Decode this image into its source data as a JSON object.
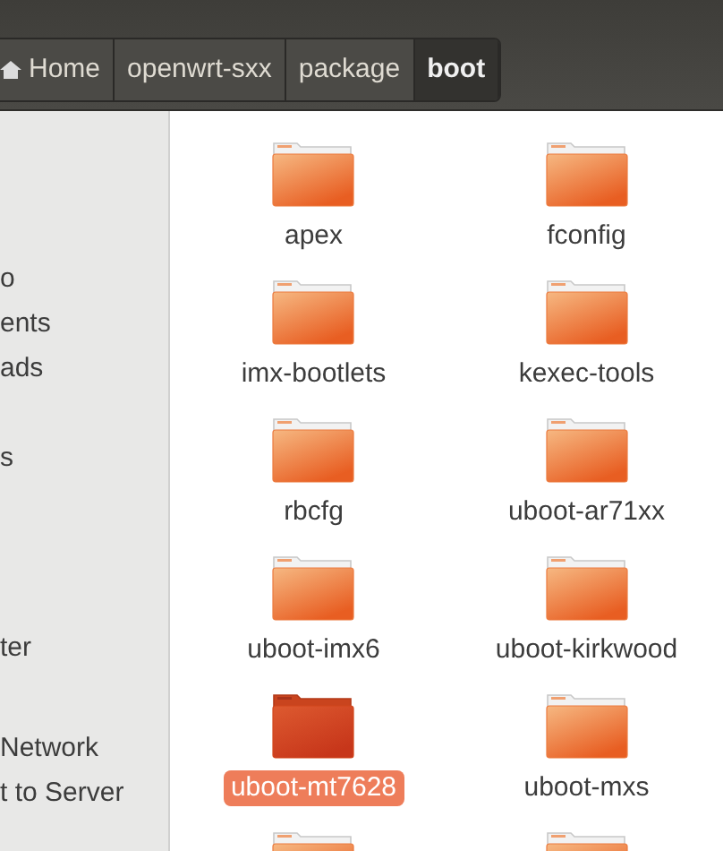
{
  "breadcrumb": [
    {
      "label": "Home",
      "kind": "home",
      "selected": false
    },
    {
      "label": "openwrt-sxx",
      "kind": "folder",
      "selected": false
    },
    {
      "label": "package",
      "kind": "folder",
      "selected": false
    },
    {
      "label": "boot",
      "kind": "folder",
      "selected": true
    }
  ],
  "sidebar": {
    "sections": [
      {
        "items": [
          "o",
          "ents",
          "ads",
          "s"
        ]
      },
      {
        "items": [
          "ter"
        ]
      },
      {
        "items": [
          "Network",
          "t to Server"
        ]
      }
    ]
  },
  "files": [
    {
      "name": "apex",
      "selected": false
    },
    {
      "name": "fconfig",
      "selected": false
    },
    {
      "name": "imx-bootlets",
      "selected": false
    },
    {
      "name": "kexec-tools",
      "selected": false
    },
    {
      "name": "rbcfg",
      "selected": false
    },
    {
      "name": "uboot-ar71xx",
      "selected": false
    },
    {
      "name": "uboot-imx6",
      "selected": false
    },
    {
      "name": "uboot-kirkwood",
      "selected": false
    },
    {
      "name": "uboot-mt7628",
      "selected": true
    },
    {
      "name": "uboot-mxs",
      "selected": false
    },
    {
      "selected": false
    },
    {
      "selected": false
    }
  ]
}
